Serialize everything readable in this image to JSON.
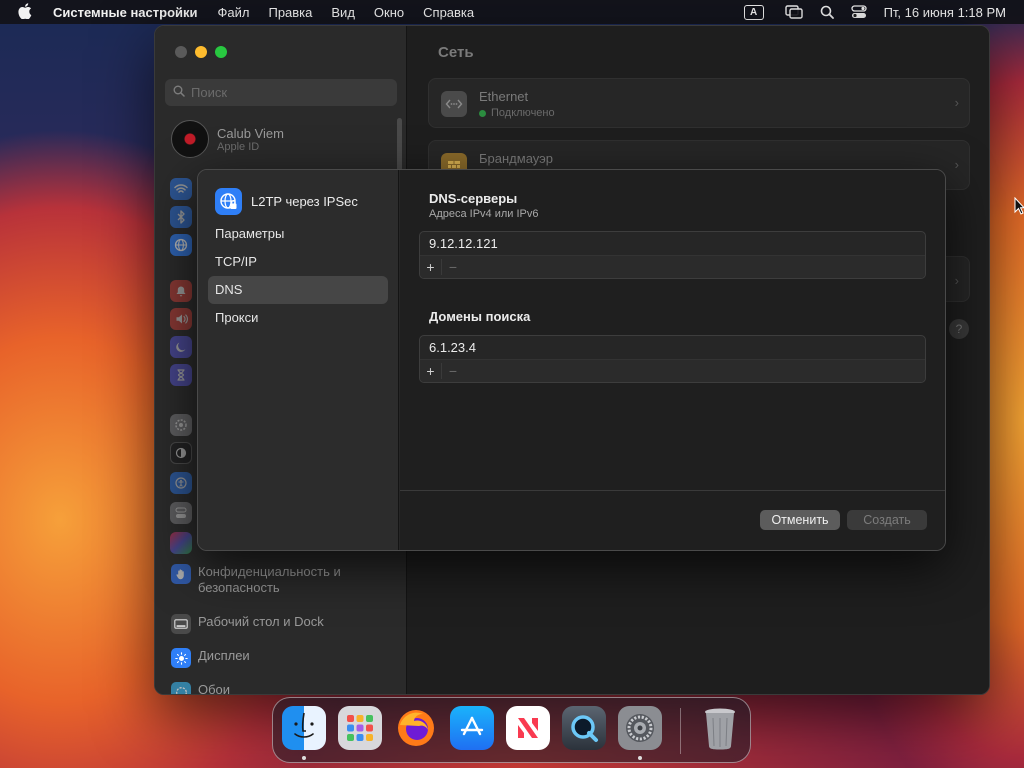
{
  "menubar": {
    "apple_icon": "apple-logo-icon",
    "app_name": "Системные настройки",
    "menus": [
      "Файл",
      "Правка",
      "Вид",
      "Окно",
      "Справка"
    ],
    "input_source": "A",
    "datetime": "Пт, 16 июня  1:18 PM"
  },
  "settings": {
    "search_placeholder": "Поиск",
    "user": {
      "name": "Calub Viem",
      "subtitle": "Apple ID"
    },
    "sidebar_items": [
      {
        "label": "Конфиденциальность и безопасность",
        "icon": "hand-icon",
        "color": "#3478f6"
      },
      {
        "label": "Рабочий стол и Dock",
        "icon": "dock-icon",
        "color": "#4a4a4a"
      },
      {
        "label": "Дисплеи",
        "icon": "sun-icon",
        "color": "#2f7ff7"
      },
      {
        "label": "Обои",
        "icon": "wallpaper-icon",
        "color": "#39a6d8"
      }
    ],
    "content_title": "Сеть",
    "network_services": [
      {
        "name": "Ethernet",
        "status": "Подключено",
        "icon": "ethernet-icon"
      },
      {
        "name": "Брандмауэр",
        "status": "",
        "icon": "firewall-icon"
      }
    ],
    "help_label": "?"
  },
  "vpn_sheet": {
    "title": "L2TP через IPSec",
    "nav": [
      "Параметры",
      "TCP/IP",
      "DNS",
      "Прокси"
    ],
    "active_nav": "DNS",
    "dns_servers": {
      "title": "DNS-серверы",
      "subtitle": "Адреса IPv4 или IPv6",
      "entries": [
        "9.12.12.121"
      ]
    },
    "search_domains": {
      "title": "Домены поиска",
      "entries": [
        "6.1.23.4"
      ]
    },
    "add_label": "+",
    "remove_label": "−",
    "cancel_label": "Отменить",
    "create_label": "Создать"
  },
  "dock": {
    "apps": [
      {
        "name": "Finder",
        "icon": "finder-icon",
        "running": true
      },
      {
        "name": "Launchpad",
        "icon": "launchpad-icon",
        "running": false
      },
      {
        "name": "Firefox",
        "icon": "firefox-icon",
        "running": false
      },
      {
        "name": "App Store",
        "icon": "app-store-icon",
        "running": false
      },
      {
        "name": "News",
        "icon": "news-icon",
        "running": false
      },
      {
        "name": "QuickTime Player",
        "icon": "quicktime-icon",
        "running": false
      },
      {
        "name": "Системные настройки",
        "icon": "system-settings-icon",
        "running": true
      },
      {
        "name": "Корзина",
        "icon": "trash-icon",
        "running": false
      }
    ]
  }
}
